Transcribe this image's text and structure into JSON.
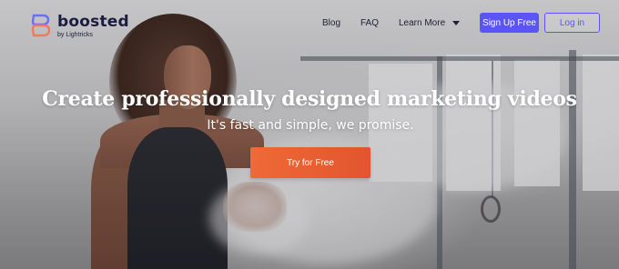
{
  "brand": {
    "name": "boosted",
    "byline": "by Lightricks",
    "logo_icon": "boosted-logo-icon"
  },
  "nav": {
    "blog": "Blog",
    "faq": "FAQ",
    "learn_more": "Learn More",
    "signup": "Sign Up Free",
    "login": "Log in"
  },
  "hero": {
    "headline": "Create professionally designed marketing videos",
    "subheadline": "It's fast and simple, we promise.",
    "cta": "Try for Free"
  },
  "colors": {
    "accent": "#5b55f5",
    "cta": "#e95f33",
    "brand_text": "#1b1c3f"
  }
}
